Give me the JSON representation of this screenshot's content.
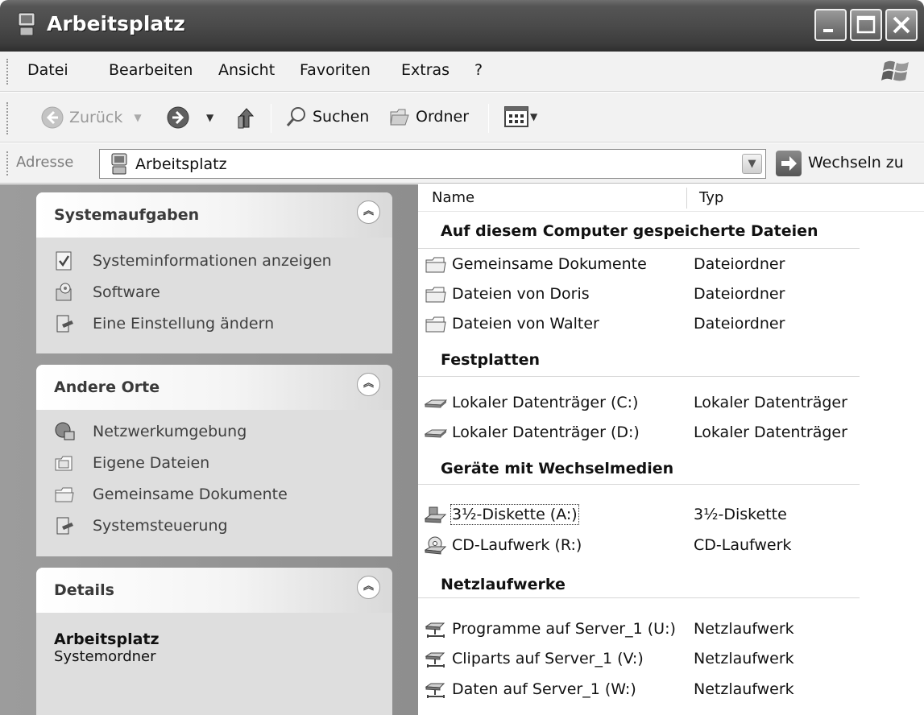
{
  "window": {
    "title": "Arbeitsplatz"
  },
  "menu": [
    "Datei",
    "Bearbeiten",
    "Ansicht",
    "Favoriten",
    "Extras",
    "?"
  ],
  "toolbar": {
    "back_label": "Zurück",
    "search_label": "Suchen",
    "folders_label": "Ordner"
  },
  "address": {
    "label": "Adresse",
    "value": "Arbeitsplatz",
    "go_label": "Wechseln zu"
  },
  "left_pane": {
    "system_tasks": {
      "title": "Systemaufgaben",
      "items": [
        "Systeminformationen anzeigen",
        "Software",
        "Eine Einstellung ändern"
      ]
    },
    "other_places": {
      "title": "Andere Orte",
      "items": [
        "Netzwerkumgebung",
        "Eigene Dateien",
        "Gemeinsame Dokumente",
        "Systemsteuerung"
      ]
    },
    "details": {
      "title": "Details",
      "name": "Arbeitsplatz",
      "type": "Systemordner"
    }
  },
  "list": {
    "columns": {
      "name": "Name",
      "type": "Typ"
    },
    "groups": [
      {
        "title": "Auf diesem Computer gespeicherte Dateien",
        "items": [
          {
            "name": "Gemeinsame Dokumente",
            "type": "Dateiordner",
            "icon": "folder-icon"
          },
          {
            "name": "Dateien von Doris",
            "type": "Dateiordner",
            "icon": "folder-icon"
          },
          {
            "name": "Dateien von Walter",
            "type": "Dateiordner",
            "icon": "folder-icon"
          }
        ]
      },
      {
        "title": "Festplatten",
        "items": [
          {
            "name": "Lokaler Datenträger (C:)",
            "type": "Lokaler Datenträger",
            "icon": "hard-drive-icon"
          },
          {
            "name": "Lokaler Datenträger (D:)",
            "type": "Lokaler Datenträger",
            "icon": "hard-drive-icon"
          }
        ]
      },
      {
        "title": "Geräte mit Wechselmedien",
        "items": [
          {
            "name": "3½-Diskette (A:)",
            "type": "3½-Diskette",
            "icon": "floppy-drive-icon"
          },
          {
            "name": "CD-Laufwerk (R:)",
            "type": "CD-Laufwerk",
            "icon": "cd-drive-icon"
          }
        ]
      },
      {
        "title": "Netzlaufwerke",
        "items": [
          {
            "name": "Programme auf Server_1 (U:)",
            "type": "Netzlaufwerk",
            "icon": "network-drive-icon"
          },
          {
            "name": "Cliparts auf Server_1 (V:)",
            "type": "Netzlaufwerk",
            "icon": "network-drive-icon"
          },
          {
            "name": "Daten auf Server_1 (W:)",
            "type": "Netzlaufwerk",
            "icon": "network-drive-icon"
          }
        ]
      }
    ]
  }
}
